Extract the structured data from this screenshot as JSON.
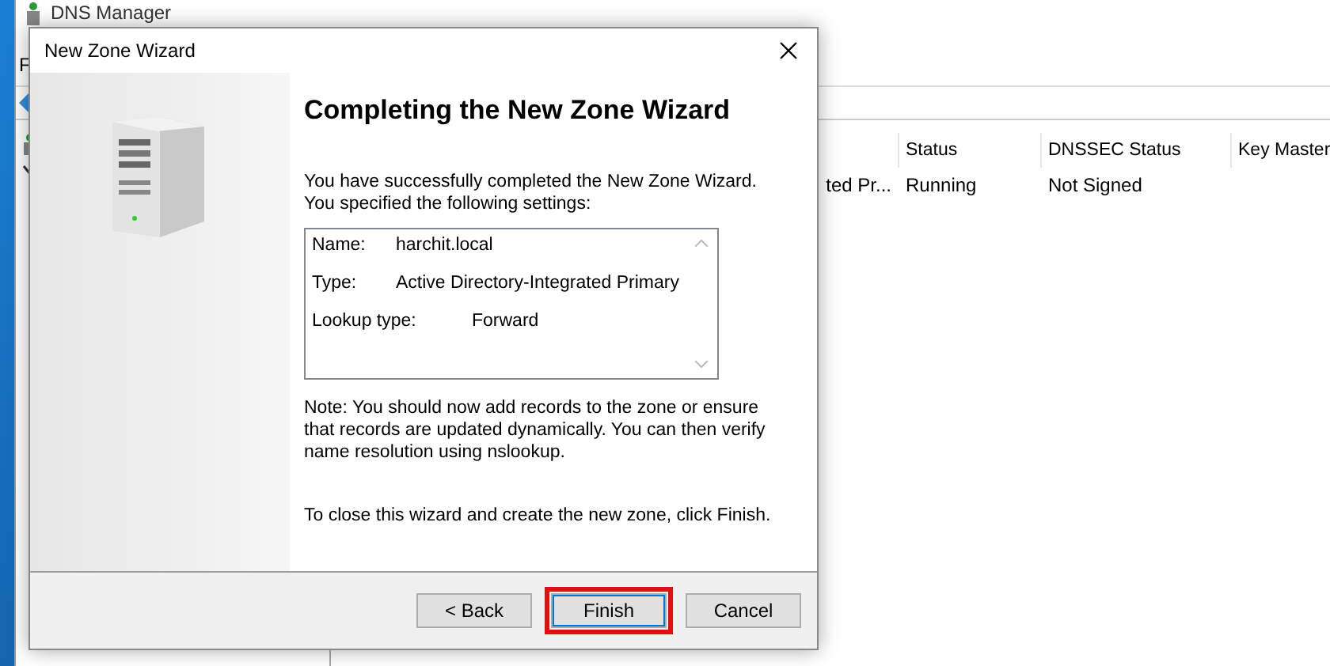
{
  "background_window": {
    "title": "DNS Manager",
    "menu": [
      "F"
    ],
    "columns": [
      {},
      {
        "label": "Status"
      },
      {
        "label": "DNSSEC Status"
      },
      {
        "label": "Key Master"
      }
    ],
    "rows": [
      {
        "cells": [
          "ted Pr...",
          "Running",
          "Not Signed"
        ]
      }
    ]
  },
  "dialog": {
    "title": "New Zone Wizard",
    "heading": "Completing the New Zone Wizard",
    "intro": "You have successfully completed the New Zone Wizard. You specified the following settings:",
    "settings": [
      {
        "label": "Name:",
        "value": "harchit.local"
      },
      {
        "label": "Type:",
        "value": "Active Directory-Integrated Primary"
      },
      {
        "label": "Lookup type:",
        "value": "Forward"
      }
    ],
    "note": "Note: You should now add records to the zone or ensure that records are updated dynamically. You can then verify name resolution using nslookup.",
    "closing": "To close this wizard and create the new zone, click Finish.",
    "buttons": [
      {
        "label": "< Back",
        "highlighted": false
      },
      {
        "label": "Finish",
        "highlighted": true
      },
      {
        "label": "Cancel",
        "highlighted": false
      }
    ]
  }
}
